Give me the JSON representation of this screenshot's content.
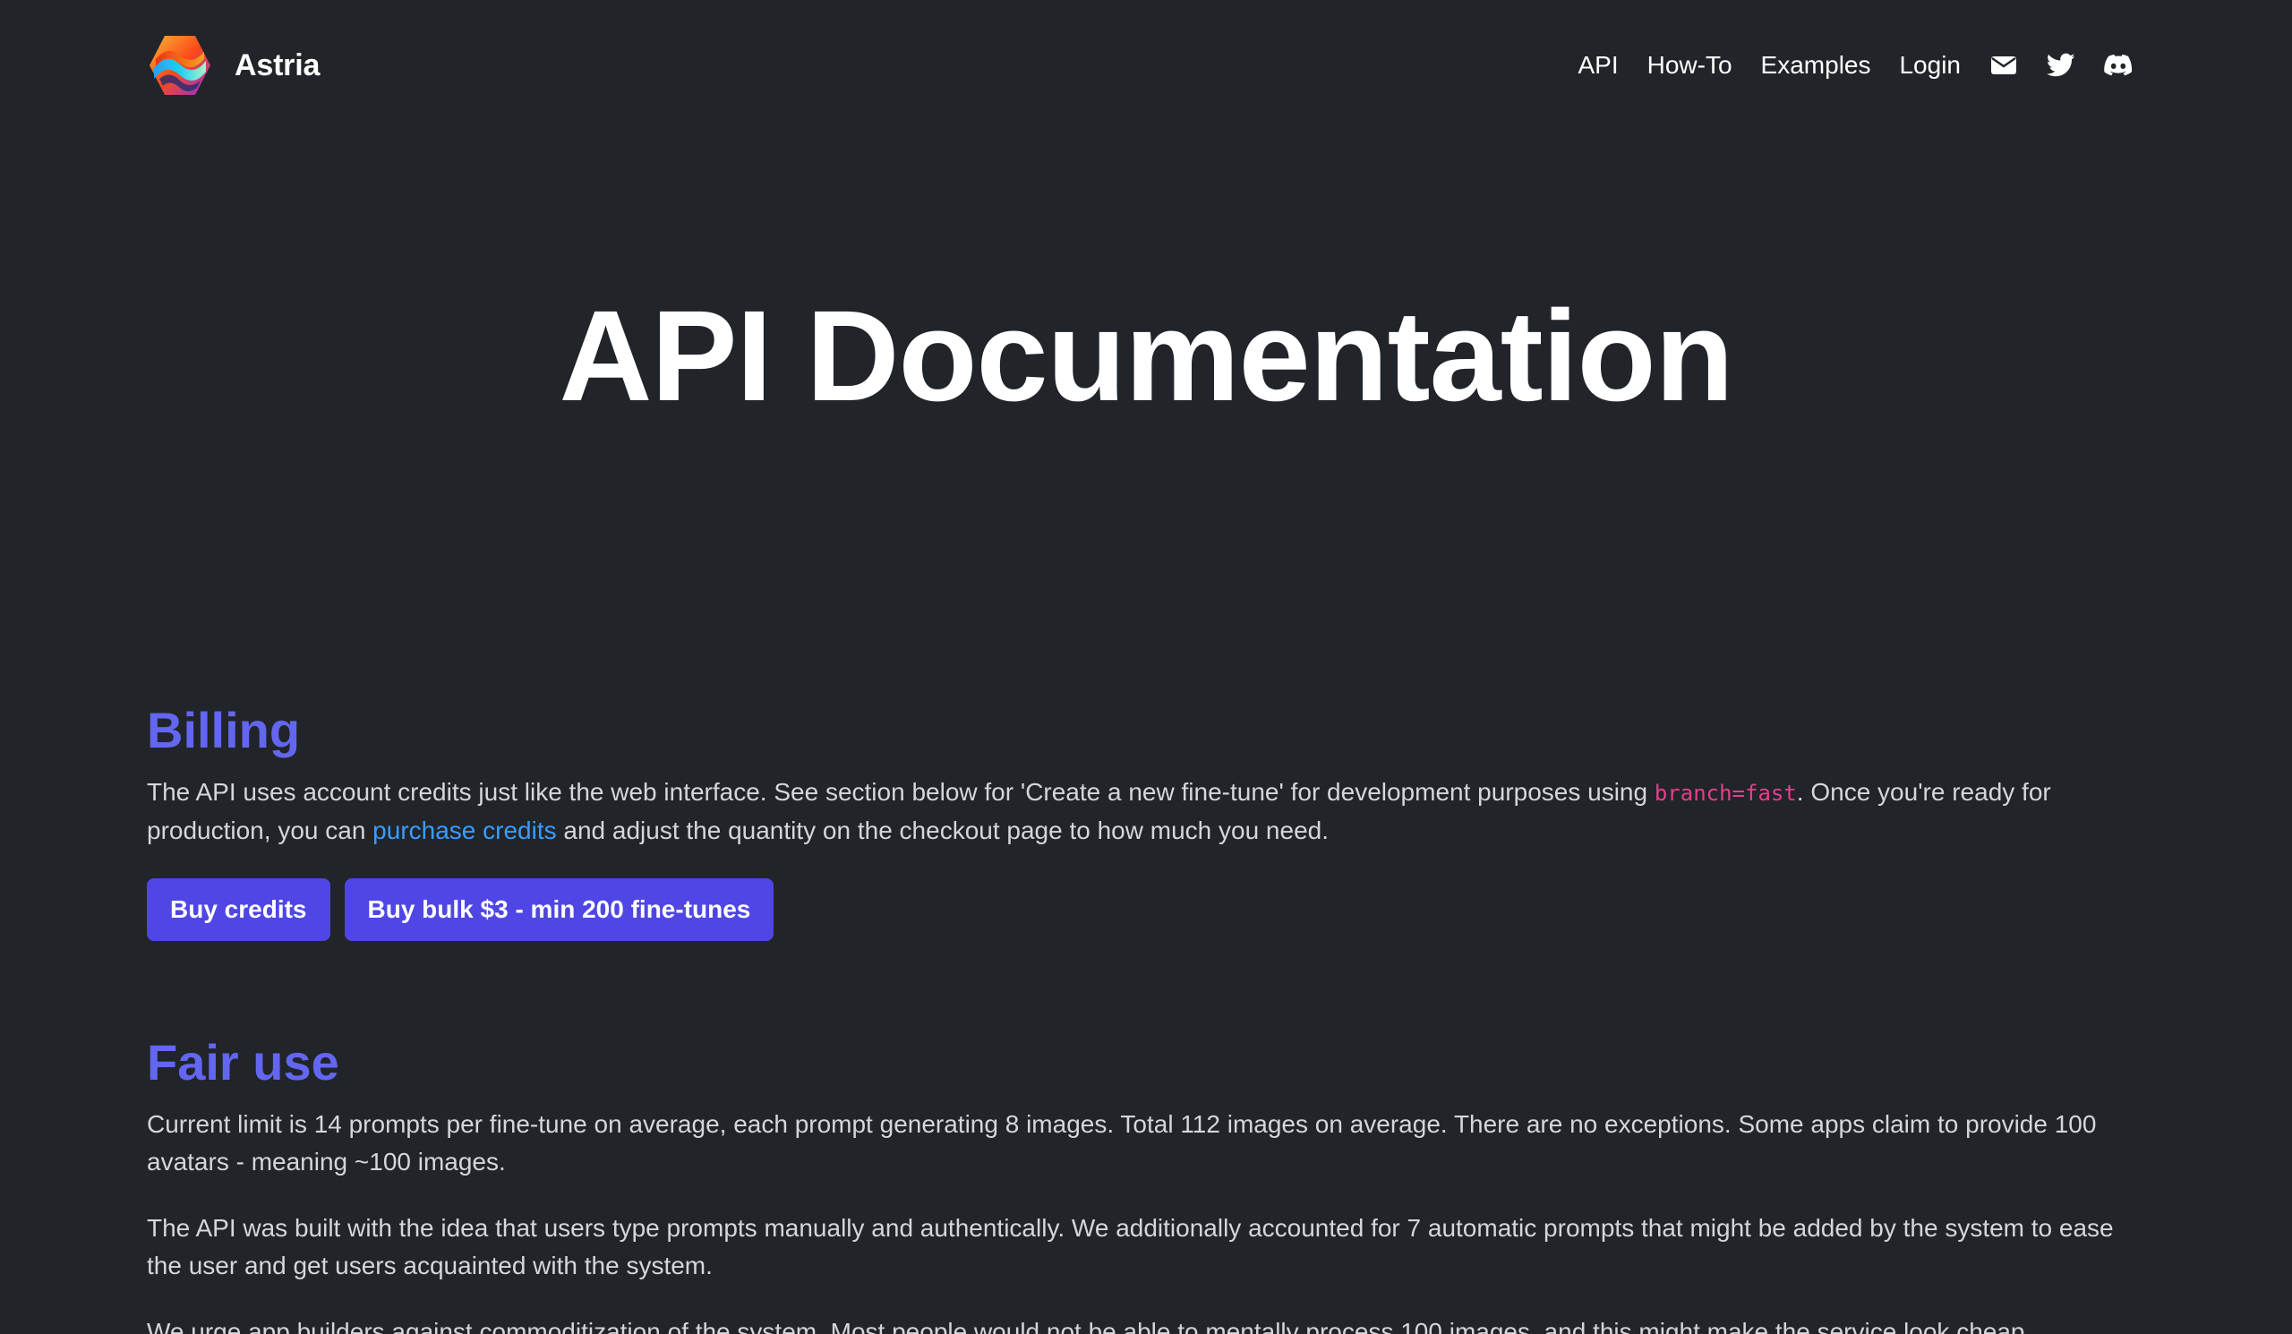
{
  "header": {
    "brand_name": "Astria",
    "nav": [
      {
        "label": "API"
      },
      {
        "label": "How-To"
      },
      {
        "label": "Examples"
      },
      {
        "label": "Login"
      }
    ],
    "social_icons": [
      "mail-icon",
      "twitter-icon",
      "discord-icon"
    ]
  },
  "hero": {
    "title": "API Documentation"
  },
  "billing": {
    "title": "Billing",
    "text_1": "The API uses account credits just like the web interface. See section below for 'Create a new fine-tune' for development purposes using ",
    "code": "branch=fast",
    "text_2": ". Once you're ready for production, you can ",
    "link": "purchase credits",
    "text_3": " and adjust the quantity on the checkout page to how much you need.",
    "buttons": [
      {
        "label": "Buy credits"
      },
      {
        "label": "Buy bulk $3 - min 200 fine-tunes"
      }
    ]
  },
  "fair_use": {
    "title": "Fair use",
    "paragraphs": [
      "Current limit is 14 prompts per fine-tune on average, each prompt generating 8 images. Total 112 images on average. There are no exceptions. Some apps claim to provide 100 avatars - meaning ~100 images.",
      "The API was built with the idea that users type prompts manually and authentically. We additionally accounted for 7 automatic prompts that might be added by the system to ease the user and get users acquainted with the system.",
      "We urge app builders against commoditization of the system. Most people would not be able to mentally process 100 images, and this might make the service look cheap."
    ]
  },
  "colors": {
    "background": "#212429",
    "accent": "#6366f1",
    "button": "#4f46e5",
    "link": "#3b9cff",
    "code": "#e83e8c"
  }
}
